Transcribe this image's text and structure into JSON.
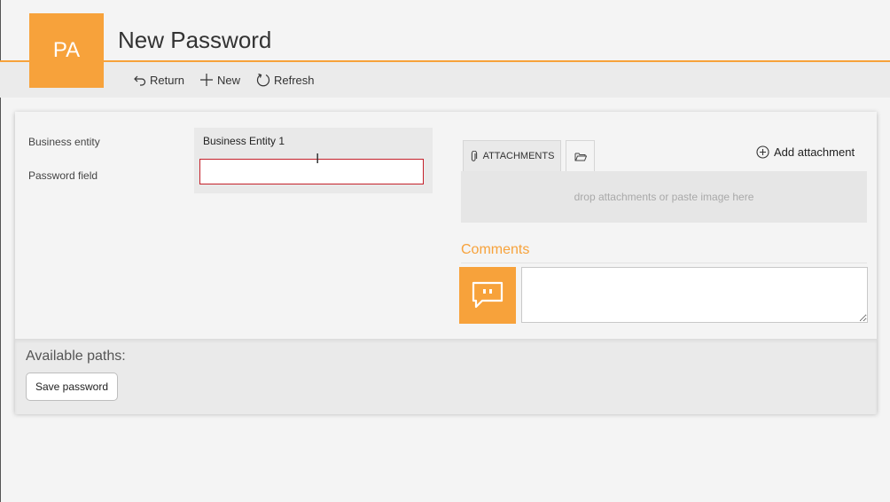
{
  "header": {
    "avatar_initials": "PA",
    "title": "New Password",
    "accent_color": "#f7a23b"
  },
  "toolbar": {
    "return_label": "Return",
    "new_label": "New",
    "refresh_label": "Refresh",
    "return_icon": "return-arrow-icon",
    "new_icon": "plus-icon",
    "refresh_icon": "refresh-icon"
  },
  "form": {
    "business_entity_label": "Business entity",
    "business_entity_value": "Business Entity 1",
    "password_label": "Password field",
    "password_value": "",
    "error_color": "#c4202a"
  },
  "attachments": {
    "tab_label": "ATTACHMENTS",
    "tab_icon": "paperclip-icon",
    "folder_icon": "folder-icon",
    "add_label": "Add attachment",
    "dropzone_text": "drop attachments or paste image here"
  },
  "comments": {
    "title": "Comments",
    "icon": "speech-bubble-icon",
    "value": ""
  },
  "paths": {
    "title": "Available paths:",
    "save_label": "Save password"
  }
}
